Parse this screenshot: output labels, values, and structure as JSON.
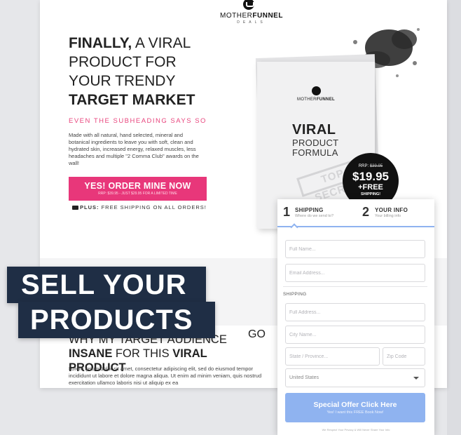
{
  "brand": {
    "name_regular": "MOTHER",
    "name_bold": "FUNNEL",
    "tag": "DEALS"
  },
  "hero": {
    "headline_l1_bold": "FINALLY,",
    "headline_l1_rest": " A VIRAL",
    "headline_l2": "PRODUCT FOR",
    "headline_l3": "YOUR TRENDY",
    "headline_l4": "TARGET MARKET",
    "subheading": "EVEN THE SUBHEADING SAYS SO",
    "body": "Made with all natural, hand selected, mineral and botanical ingredients to leave you with soft, clean and hydrated skin, increased energy, relaxed muscles, less headaches and multiple \"2 Comma Club\" awards on the wall!",
    "cta_label": "YES! ORDER MINE NOW",
    "cta_sub": "RRP: $39.95 - JUST $29.95 FOR A LIMITED TIME",
    "shipping_bold": "PLUS:",
    "shipping_text": " FREE SHIPPING ON ALL ORDERS!"
  },
  "book": {
    "brand_regular": "MOTHER",
    "brand_bold": "FUNNEL",
    "brand_tag": "DEALS",
    "title": "VIRAL",
    "line1": "PRODUCT",
    "line2": "FORMULA",
    "stamp": "TOP SECRET"
  },
  "badge": {
    "rrp_label": "RRP:",
    "rrp_price": "$39.95",
    "price": "$19.95",
    "free": "+FREE",
    "shipping": "SHIPPING!"
  },
  "overlay": {
    "line1": "SELL YOUR",
    "line2": "PRODUCTS",
    "behind": "GO"
  },
  "section2": {
    "l1_rest": "WHY MY TARGET AUDIENCE",
    "l2_bold_a": "INSANE",
    "l2_mid": " FOR THIS ",
    "l2_bold_b": "VIRAL PRODUCT",
    "lorem": "Lorem ipsum dolor sit amet, consectetur adipiscing elit, sed do eiusmod tempor incididunt ut labore et dolore magna aliqua. Ut enim ad minim veniam, quis nostrud exercitation ullamco laboris nisi ut aliquip ex ea"
  },
  "form": {
    "step1": {
      "num": "1",
      "title": "SHIPPING",
      "sub": "Where do we send to?"
    },
    "step2": {
      "num": "2",
      "title": "YOUR INFO",
      "sub": "Your billing info"
    },
    "full_name_placeholder": "Full Name...",
    "email_placeholder": "Email Address...",
    "shipping_label": "SHIPPING",
    "address_placeholder": "Full Address...",
    "city_placeholder": "City Name...",
    "state_placeholder": "State / Province...",
    "zip_placeholder": "Zip Code",
    "country_selected": "United States",
    "submit_label": "Special Offer Click Here",
    "submit_sub": "Yes! I want this FREE Book Now!",
    "fine_print": "We Respect Your Privacy & Will Never Share Your Info"
  },
  "colors": {
    "accent_pink": "#e8377a",
    "form_blue": "#8fb3f0",
    "overlay_navy": "#1f2e45"
  }
}
